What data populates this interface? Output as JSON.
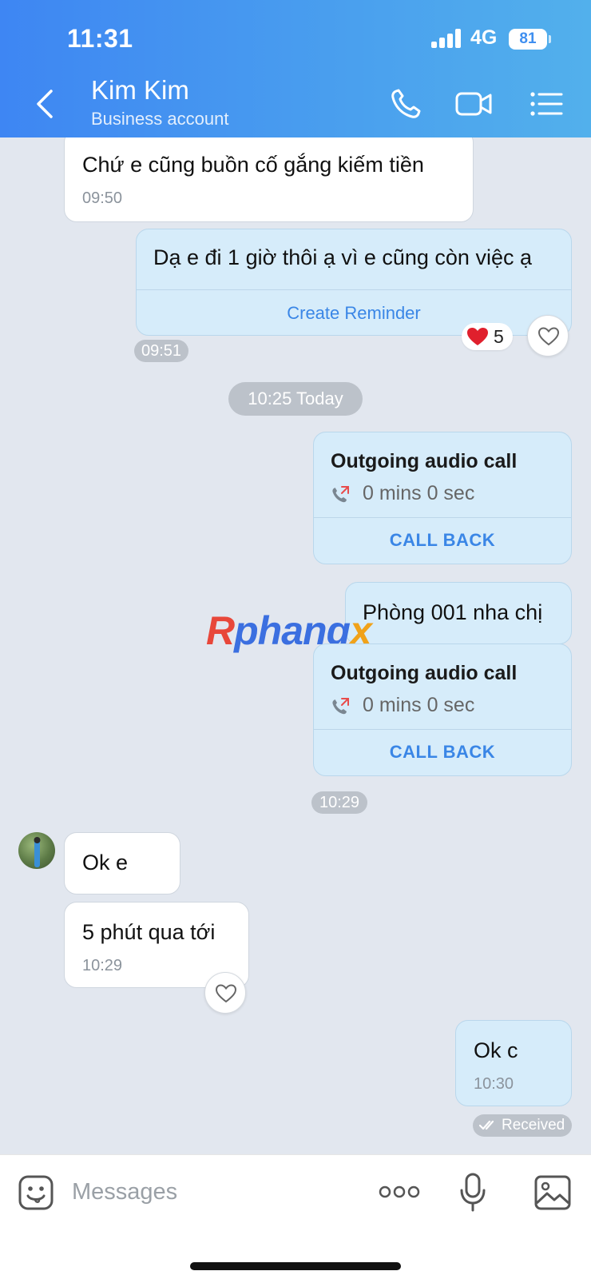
{
  "status_bar": {
    "time": "11:31",
    "network": "4G",
    "battery": "81"
  },
  "header": {
    "name": "Kim Kim",
    "subtitle": "Business account"
  },
  "messages": {
    "m1": {
      "text": "Chứ e cũng buồn cố gắng kiếm tiền",
      "time": "09:50"
    },
    "m2": {
      "text": "Dạ e đi 1 giờ thôi ạ vì e cũng còn việc ạ",
      "action": "Create Reminder",
      "time": "09:51",
      "reaction_count": "5"
    },
    "day_divider": "10:25 Today",
    "call1": {
      "title": "Outgoing audio call",
      "duration": "0 mins 0 sec",
      "action": "CALL BACK"
    },
    "m3": {
      "text": "Phòng 001 nha chị"
    },
    "call2": {
      "title": "Outgoing audio call",
      "duration": "0 mins 0 sec",
      "action": "CALL BACK",
      "time": "10:29"
    },
    "m4": {
      "text": "Ok e"
    },
    "m5": {
      "text": "5 phút qua tới",
      "time": "10:29"
    },
    "m6": {
      "text": "Ok c",
      "time": "10:30",
      "status": "Received"
    }
  },
  "watermark": "Rphangx",
  "composer": {
    "placeholder": "Messages"
  },
  "colors": {
    "header_gradient_start": "#3e86f3",
    "header_gradient_end": "#52b0ec",
    "chat_bg": "#e2e7ef",
    "outgoing_bubble": "#d6ecfa",
    "accent": "#3a86e6",
    "heart": "#e0202d"
  },
  "icons": [
    "back-chevron-icon",
    "phone-icon",
    "video-camera-icon",
    "menu-list-icon",
    "heart-icon",
    "outgoing-call-icon",
    "double-check-icon",
    "sticker-icon",
    "more-icon",
    "microphone-icon",
    "image-icon"
  ]
}
